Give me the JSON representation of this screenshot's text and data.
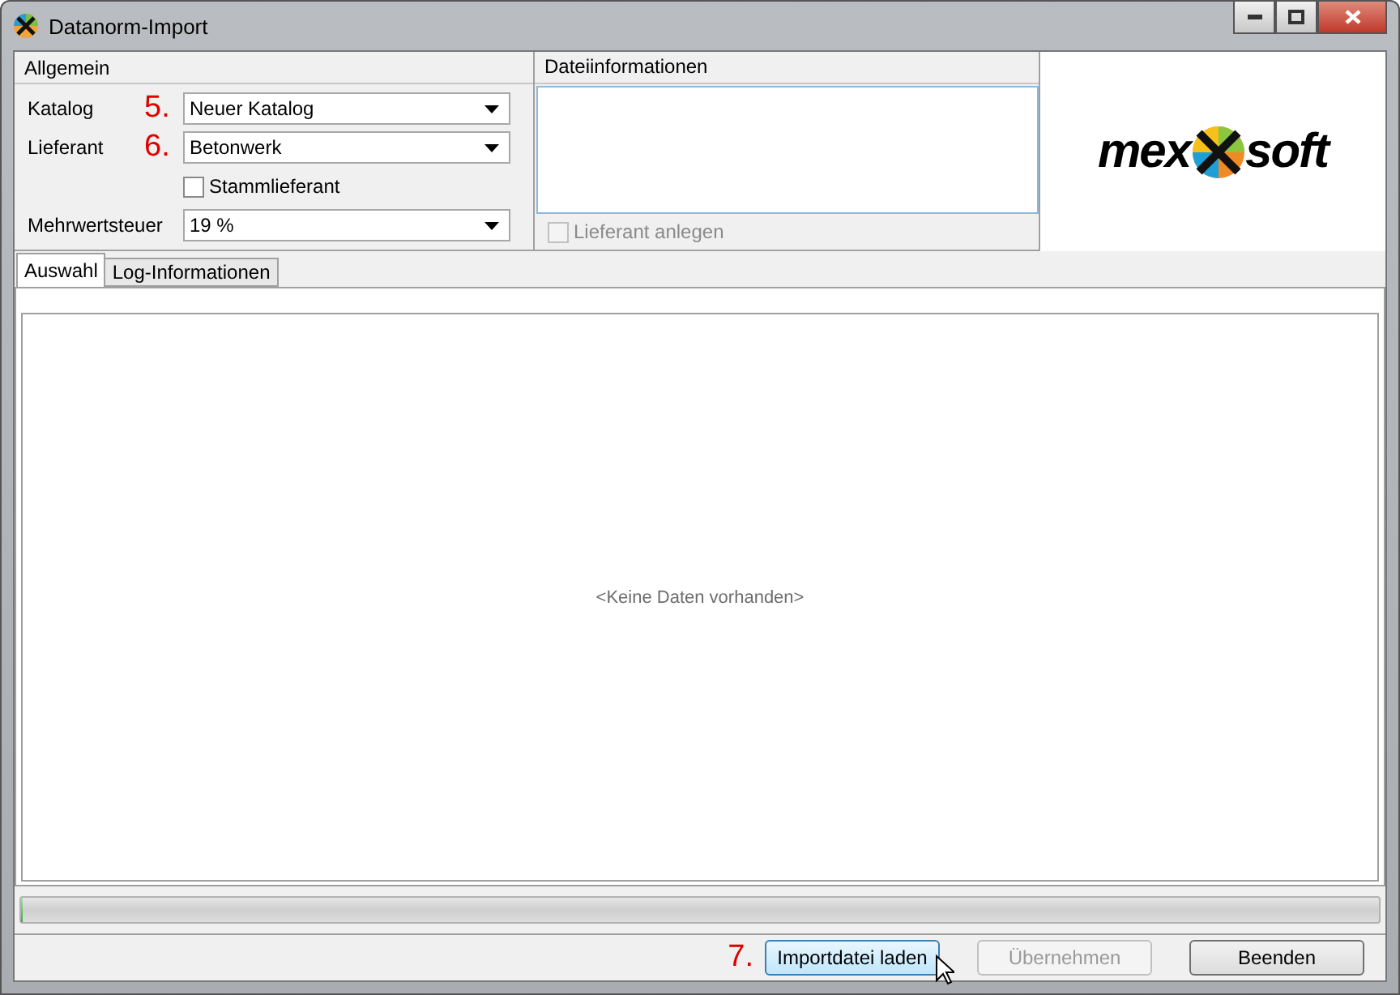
{
  "window": {
    "title": "Datanorm-Import"
  },
  "general": {
    "title": "Allgemein",
    "fields": [
      {
        "label": "Katalog",
        "marker": "5.",
        "value": "Neuer Katalog"
      },
      {
        "label": "Lieferant",
        "marker": "6.",
        "value": "Betonwerk"
      },
      {
        "label": "Mehrwertsteuer",
        "value": "19 %"
      }
    ],
    "checkbox": {
      "label": "Stammlieferant",
      "checked": false
    }
  },
  "file_info": {
    "title": "Dateiinformationen",
    "checkbox": {
      "label": "Lieferant anlegen",
      "checked": false,
      "disabled": true
    }
  },
  "logo": {
    "left": "mex",
    "right": "soft"
  },
  "tabs": [
    {
      "label": "Auswahl",
      "selected": true
    },
    {
      "label": "Log-Informationen",
      "selected": false
    }
  ],
  "empty_message": "<Keine Daten vorhanden>",
  "progress": {
    "level": 0
  },
  "footer": {
    "marker": "7.",
    "buttons": [
      {
        "label": "Importdatei laden",
        "disabled": false,
        "hovered": true
      },
      {
        "label": "Übernehmen",
        "disabled": true,
        "hovered": false
      },
      {
        "label": "Beenden",
        "disabled": false,
        "hovered": false
      }
    ]
  }
}
